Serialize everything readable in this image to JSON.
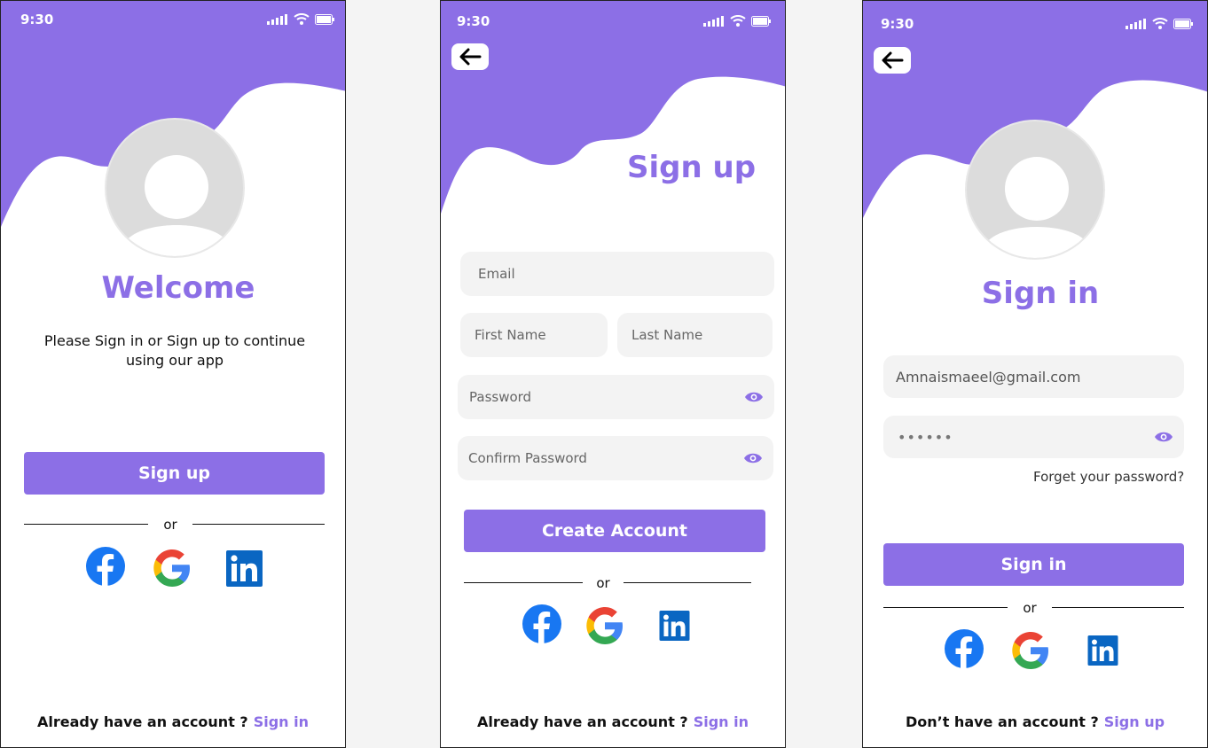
{
  "status_time": "9:30",
  "colors": {
    "accent": "#8c6fe6",
    "field_bg": "#f3f3f3",
    "avatar_bg": "#dcdcdc"
  },
  "welcome": {
    "title": "Welcome",
    "subtitle_line1": "Please Sign in or Sign up to continue",
    "subtitle_line2": "using our app",
    "signup_button": "Sign up",
    "or_text": "or",
    "footer_question": "Already have an account ?",
    "footer_link": "Sign in"
  },
  "signup": {
    "title": "Sign up",
    "email_placeholder": "Email",
    "first_name_placeholder": "First Name",
    "last_name_placeholder": "Last Name",
    "password_placeholder": "Password",
    "confirm_password_placeholder": "Confirm Password",
    "create_button": "Create Account",
    "or_text": "or",
    "footer_question": "Already have an account ?",
    "footer_link": "Sign in"
  },
  "signin": {
    "title": "Sign in",
    "email_value": "Amnaismaeel@gmail.com",
    "password_value": "••••••",
    "forget_link": "Forget your password?",
    "signin_button": "Sign in",
    "or_text": "or",
    "footer_question": "Don’t have an account ?",
    "footer_link": "Sign up"
  },
  "icons": [
    "signal-icon",
    "wifi-icon",
    "battery-icon",
    "back-arrow-icon",
    "avatar-icon",
    "eye-icon",
    "facebook-icon",
    "google-icon",
    "linkedin-icon"
  ]
}
